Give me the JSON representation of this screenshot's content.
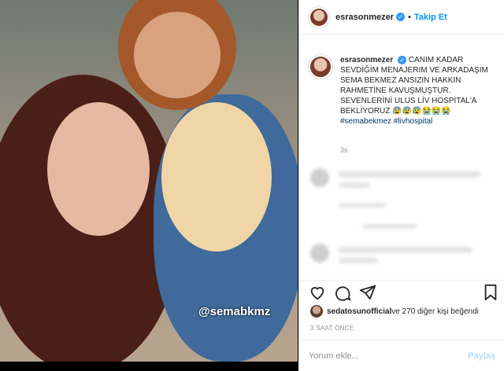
{
  "post": {
    "username": "esrasonmezer",
    "verified_mark": "✓",
    "dot": "•",
    "follow_label": "Takip Et",
    "caption_user": "esrasonmezer",
    "caption": "CANIM KADAR SEVDİĞİM MENAJERIM VE ARKADAŞIM SEMA BEKMEZ ANSIZIN HAKKIN RAHMETİNE KAVUŞMUŞTUR. SEVENLERİNİ ULUS LİV HOSPİTAL'A BEKLİYORUZ 😰😰😰😭😭😭",
    "hashtags": "#semabekmez #livhospital",
    "caption_time": "3s",
    "photo_watermark": "@semabkmz",
    "likes_user": "sedatosunofficial",
    "likes_rest": " ve 270 diğer kişi beğendi",
    "time_ago": "3 SAAT ÖNCE",
    "comment_placeholder": "Yorum ekle...",
    "share_label": "Paylaş"
  },
  "icons": {
    "like": "heart-icon",
    "comment": "comment-icon",
    "share": "send-icon",
    "save": "bookmark-icon"
  },
  "colors": {
    "link": "#0095f6",
    "hashtag": "#00376b",
    "muted": "#8e8e8e"
  }
}
